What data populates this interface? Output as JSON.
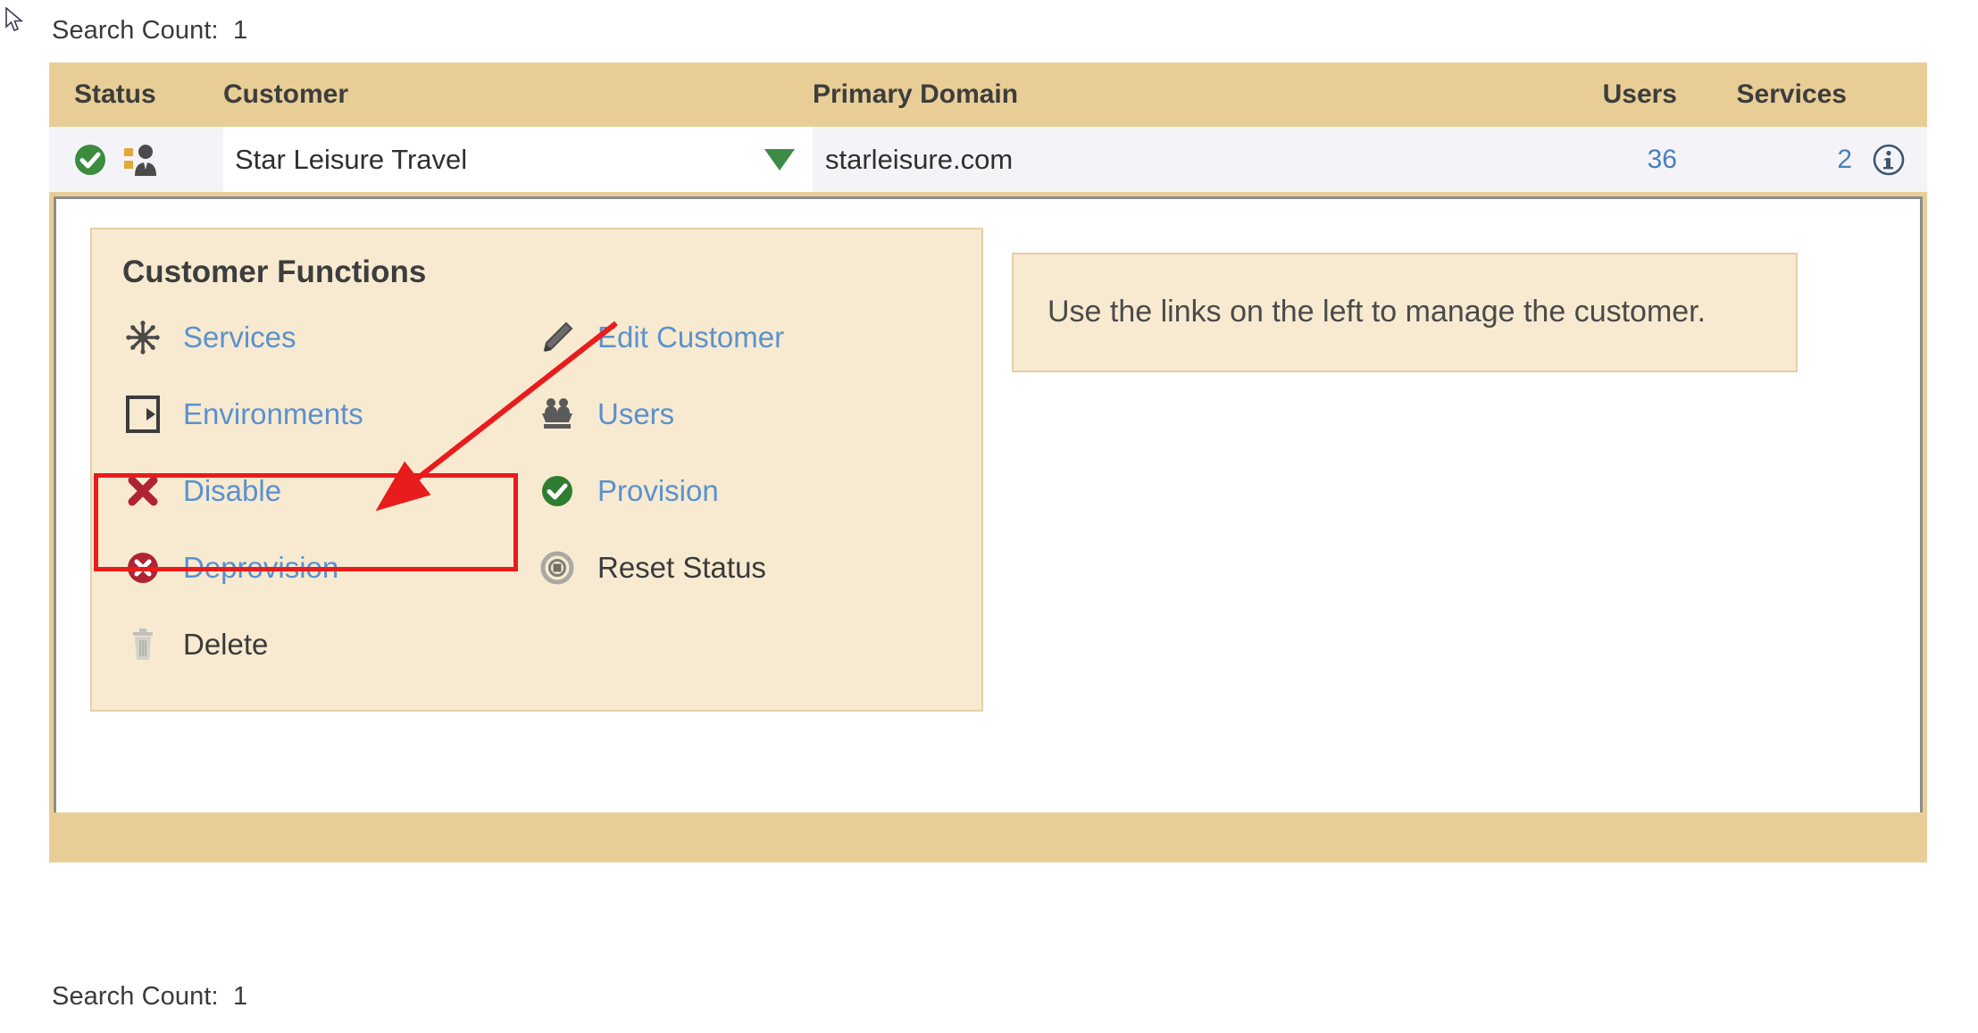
{
  "page": {
    "search_count_label_top": "Search Count:  1",
    "search_count_label_bottom": "Search Count:  1"
  },
  "table": {
    "columns": {
      "status": "Status",
      "customer": "Customer",
      "primary_domain": "Primary Domain",
      "users": "Users",
      "services": "Services"
    },
    "rows": [
      {
        "status_icon": "green-check-icon",
        "customer_type_icon": "business-person-icon",
        "customer": "Star Leisure Travel",
        "expand_icon": "triangle-down-icon",
        "primary_domain": "starleisure.com",
        "users": "36",
        "services": "2",
        "info_icon": "info-circle-icon"
      }
    ]
  },
  "detail": {
    "functions_panel": {
      "title": "Customer Functions",
      "left_items": [
        {
          "icon": "snowflake-icon",
          "label": "Services",
          "enabled": true
        },
        {
          "icon": "environment-box-icon",
          "label": "Environments",
          "enabled": true
        },
        {
          "icon": "red-x-icon",
          "label": "Disable",
          "enabled": true
        },
        {
          "icon": "red-circle-x-icon",
          "label": "Deprovision",
          "enabled": true
        },
        {
          "icon": "trash-icon",
          "label": "Delete",
          "enabled": false
        }
      ],
      "right_items": [
        {
          "icon": "pencil-icon",
          "label": "Edit Customer",
          "enabled": true
        },
        {
          "icon": "users-group-icon",
          "label": "Users",
          "enabled": true
        },
        {
          "icon": "green-check-icon",
          "label": "Provision",
          "enabled": true
        },
        {
          "icon": "reset-target-icon",
          "label": "Reset Status",
          "enabled": false
        }
      ]
    },
    "hint_panel": {
      "text": "Use the links on the left to manage the customer."
    }
  },
  "annotation": {
    "highlight_target": "Environments",
    "color": "#e81c1c"
  },
  "colors": {
    "header_tan": "#e8ce96",
    "panel_cream": "#f7ead0",
    "link_blue": "#5b91cf",
    "value_blue": "#4a7ebb",
    "green": "#3d8b47",
    "annotation_red": "#e81c1c"
  }
}
